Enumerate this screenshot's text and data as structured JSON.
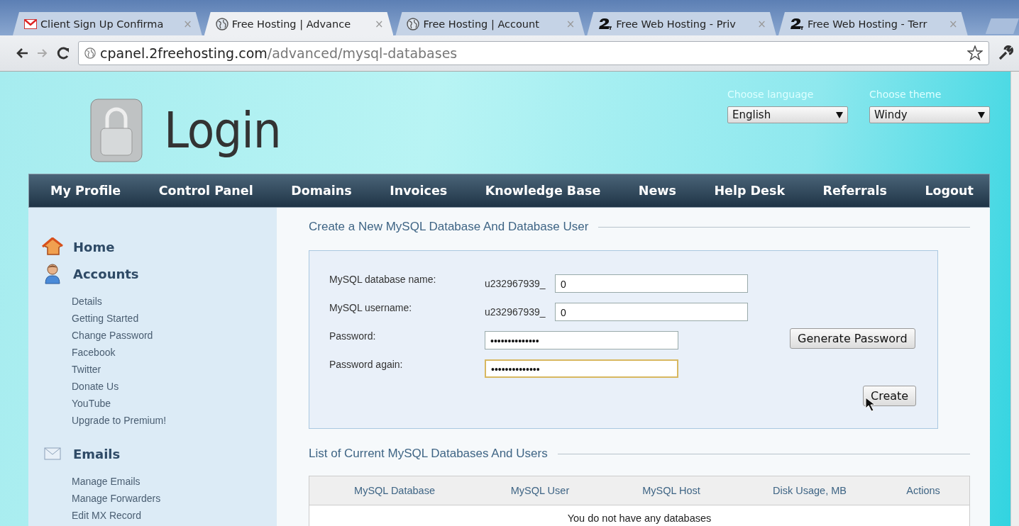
{
  "browser": {
    "tabs": [
      {
        "kind": "mail",
        "title": "Client Sign Up Confirma",
        "close": "×",
        "selected": false
      },
      {
        "kind": "globe",
        "title": "Free Hosting | Advance",
        "close": "×",
        "selected": true
      },
      {
        "kind": "globe",
        "title": "Free Hosting | Account",
        "close": "×",
        "selected": false
      },
      {
        "kind": "logo",
        "title": "Free Web Hosting - Priv",
        "close": "×",
        "selected": false
      },
      {
        "kind": "logo",
        "title": "Free Web Hosting - Terr",
        "close": "×",
        "selected": false
      }
    ],
    "address": {
      "host": "cpanel.2freehosting.com",
      "path": "/advanced/mysql-databases"
    }
  },
  "header": {
    "logo_text": "Login",
    "selects": [
      {
        "label": "Choose language",
        "value": "English"
      },
      {
        "label": "Choose theme",
        "value": "Windy"
      }
    ]
  },
  "nav": [
    "My Profile",
    "Control Panel",
    "Domains",
    "Invoices",
    "Knowledge Base",
    "News",
    "Help Desk",
    "Referrals",
    "Logout"
  ],
  "sidebar": {
    "sections": [
      {
        "kind": "home",
        "title": "Home"
      },
      {
        "kind": "user",
        "title": "Accounts",
        "items": [
          "Details",
          "Getting Started",
          "Change Password",
          "Facebook",
          "Twitter",
          "Donate Us",
          "YouTube",
          "Upgrade to Premium!"
        ]
      },
      {
        "kind": "mail",
        "title": "Emails",
        "items": [
          "Manage Emails",
          "Manage Forwarders",
          "Edit MX Record"
        ]
      }
    ]
  },
  "create_form": {
    "legend": "Create a New MySQL Database And Database User",
    "fields": [
      {
        "kind": "prefixed",
        "label": "MySQL database name:",
        "prefix": "u232967939_",
        "value": "0",
        "focused": false
      },
      {
        "kind": "prefixed",
        "label": "MySQL username:",
        "prefix": "u232967939_",
        "value": "0",
        "focused": false
      },
      {
        "kind": "password",
        "label": "Password:",
        "value": "••••••••••••••",
        "focused": false
      },
      {
        "kind": "password",
        "label": "Password again:",
        "value": "••••••••••••••",
        "focused": true
      }
    ],
    "generate_button": "Generate Password",
    "create_button": "Create"
  },
  "databases": {
    "legend": "List of Current MySQL Databases And Users",
    "columns": [
      "MySQL Database",
      "MySQL User",
      "MySQL Host",
      "Disk Usage, MB",
      "Actions"
    ],
    "empty_message": "You do not have any databases"
  }
}
